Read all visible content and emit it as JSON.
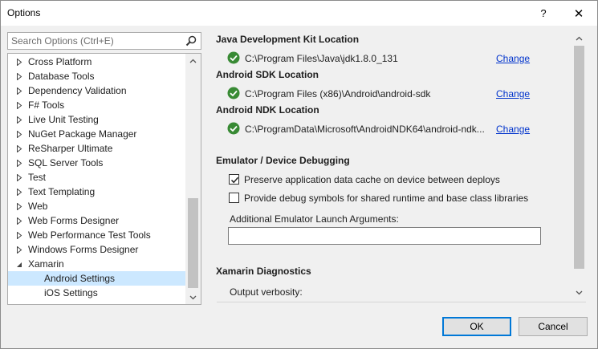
{
  "window": {
    "title": "Options",
    "help_glyph": "?",
    "close_glyph": "✕"
  },
  "search": {
    "placeholder": "Search Options (Ctrl+E)",
    "icon": "search-icon"
  },
  "tree": {
    "items": [
      {
        "label": "Cross Platform",
        "state": "collapsed"
      },
      {
        "label": "Database Tools",
        "state": "collapsed"
      },
      {
        "label": "Dependency Validation",
        "state": "collapsed"
      },
      {
        "label": "F# Tools",
        "state": "collapsed"
      },
      {
        "label": "Live Unit Testing",
        "state": "collapsed"
      },
      {
        "label": "NuGet Package Manager",
        "state": "collapsed"
      },
      {
        "label": "ReSharper Ultimate",
        "state": "collapsed"
      },
      {
        "label": "SQL Server Tools",
        "state": "collapsed"
      },
      {
        "label": "Test",
        "state": "collapsed"
      },
      {
        "label": "Text Templating",
        "state": "collapsed"
      },
      {
        "label": "Web",
        "state": "collapsed"
      },
      {
        "label": "Web Forms Designer",
        "state": "collapsed"
      },
      {
        "label": "Web Performance Test Tools",
        "state": "collapsed"
      },
      {
        "label": "Windows Forms Designer",
        "state": "collapsed"
      },
      {
        "label": "Xamarin",
        "state": "expanded"
      },
      {
        "label": "Android Settings",
        "state": "child-selected"
      },
      {
        "label": "iOS Settings",
        "state": "child"
      }
    ]
  },
  "settings": {
    "jdk": {
      "title": "Java Development Kit Location",
      "path": "C:\\Program Files\\Java\\jdk1.8.0_131",
      "change": "Change"
    },
    "sdk": {
      "title": "Android SDK Location",
      "path": "C:\\Program Files (x86)\\Android\\android-sdk",
      "change": "Change"
    },
    "ndk": {
      "title": "Android NDK Location",
      "path": "C:\\ProgramData\\Microsoft\\AndroidNDK64\\android-ndk...",
      "change": "Change"
    },
    "emulator": {
      "title": "Emulator / Device Debugging",
      "preserve_cache": {
        "label": "Preserve application data cache on device between deploys",
        "checked": true
      },
      "debug_symbols": {
        "label": "Provide debug symbols for shared runtime and base class libraries",
        "checked": false
      },
      "args_label": "Additional Emulator Launch Arguments:",
      "args_value": ""
    },
    "diagnostics": {
      "title": "Xamarin Diagnostics",
      "verbosity_label": "Output verbosity:"
    }
  },
  "buttons": {
    "ok": "OK",
    "cancel": "Cancel"
  },
  "colors": {
    "accent": "#0078d7",
    "selection": "#cce8ff",
    "link": "#0033cc",
    "ok_check": "#388a34"
  }
}
